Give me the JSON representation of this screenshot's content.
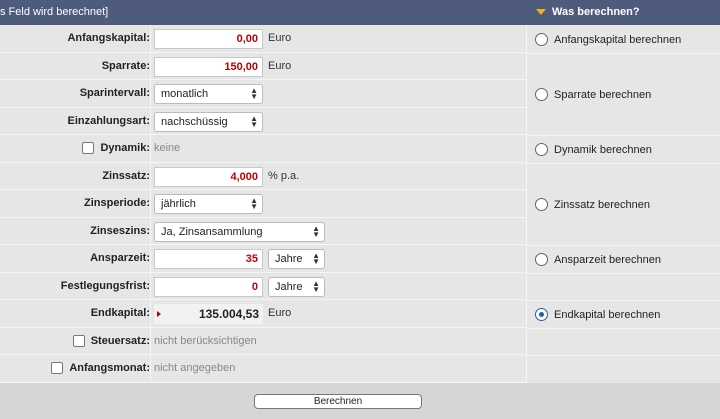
{
  "header": {
    "left_text": "s Feld wird berechnet]",
    "right_text": "Was berechnen?"
  },
  "fields": {
    "anfangskapital": {
      "label": "Anfangskapital:",
      "value": "0,00",
      "unit": "Euro"
    },
    "sparrate": {
      "label": "Sparrate:",
      "value": "150,00",
      "unit": "Euro"
    },
    "sparintervall": {
      "label": "Sparintervall:",
      "selected": "monatlich"
    },
    "einzahlungsart": {
      "label": "Einzahlungsart:",
      "selected": "nachschüssig"
    },
    "dynamik": {
      "label": "Dynamik:",
      "value": "keine"
    },
    "zinssatz": {
      "label": "Zinssatz:",
      "value": "4,000",
      "unit": "% p.a."
    },
    "zinsperiode": {
      "label": "Zinsperiode:",
      "selected": "jährlich"
    },
    "zinseszins": {
      "label": "Zinseszins:",
      "selected": "Ja, Zinsansammlung"
    },
    "ansparzeit": {
      "label": "Ansparzeit:",
      "value": "35",
      "unit_selected": "Jahre"
    },
    "festlegungsfrist": {
      "label": "Festlegungsfrist:",
      "value": "0",
      "unit_selected": "Jahre"
    },
    "endkapital": {
      "label": "Endkapital:",
      "value": "135.004,53",
      "unit": "Euro"
    },
    "steuersatz": {
      "label": "Steuersatz:",
      "value": "nicht berücksichtigen"
    },
    "anfangsmonat": {
      "label": "Anfangsmonat:",
      "value": "nicht angegeben"
    }
  },
  "calc_options": [
    {
      "label": "Anfangskapital berechnen",
      "selected": false
    },
    {
      "label": "Sparrate berechnen",
      "selected": false
    },
    {
      "label": "Dynamik berechnen",
      "selected": false
    },
    {
      "label": "Zinssatz berechnen",
      "selected": false
    },
    {
      "label": "Ansparzeit berechnen",
      "selected": false
    },
    {
      "label": "Endkapital berechnen",
      "selected": true
    }
  ],
  "footer": {
    "button_label": "Berechnen"
  },
  "colors": {
    "header_bg": "#4f5b7d",
    "accent_triangle": "#f0b020",
    "input_value": "#c00000",
    "radio_selected": "#1f5fb0"
  }
}
